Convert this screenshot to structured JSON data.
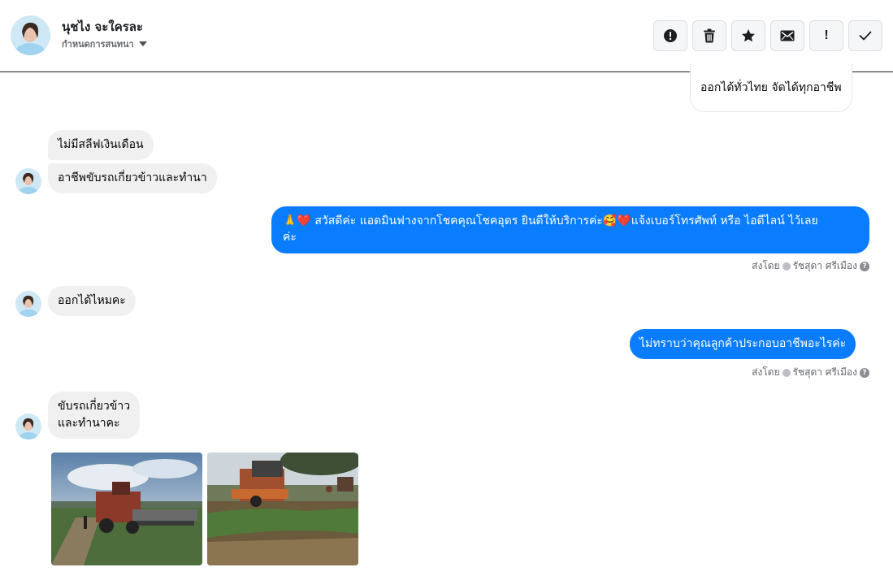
{
  "header": {
    "contact_name": "นุชไง จะใครละ",
    "assign_label": "กำหนดการสนทนา",
    "actions": [
      {
        "name": "report-spam-button",
        "icon": "alert-circle-icon"
      },
      {
        "name": "delete-button",
        "icon": "trash-icon"
      },
      {
        "name": "star-button",
        "icon": "star-icon"
      },
      {
        "name": "mark-unread-button",
        "icon": "envelope-icon"
      },
      {
        "name": "follow-up-button",
        "icon": "exclamation-icon",
        "label": "!"
      },
      {
        "name": "mark-done-button",
        "icon": "checkmark-icon"
      }
    ]
  },
  "messages": {
    "m0": "ออกได้ทั่วไทย จัดได้ทุกอาชีพ",
    "m1": "ไม่มีสลีฟเงินเดือน",
    "m2": "อาชีพขับรถเกี่ยวข้าวและทำนา",
    "m3_line1": "🙏❤️ สวัสดีค่ะ แอดมินฟางจากโชคคุณโชคอุดร ยินดีให้บริการค่ะ🥰❤️แจ้งเบอร์โทรศัพท์ หรือ ไอดีไลน์  ไว้เลย",
    "m3_line2": "ค่ะ",
    "m4": "ออกได้ไหมคะ",
    "m5": "ไม่ทราบว่าคุณลูกค้าประกอบอาชีพอะไรค่ะ",
    "m6_line1": "ขับรถเกี่ยวข้าว",
    "m6_line2": "และทำนาคะ"
  },
  "sent_by": {
    "prefix": "ส่งโดย",
    "agent": "รัชสุดา ศรีเมือง",
    "help": "?"
  },
  "colors": {
    "outgoing": "#0a7cff",
    "incoming": "#f0f0f0"
  }
}
